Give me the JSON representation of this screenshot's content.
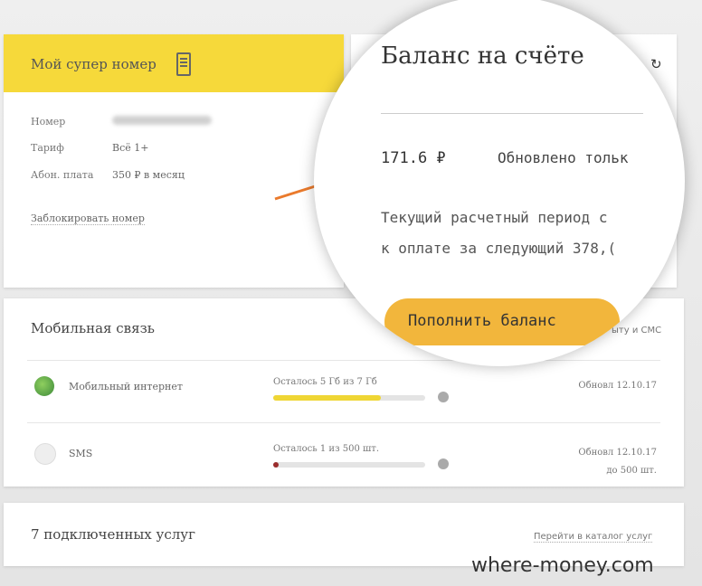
{
  "account": {
    "title": "Мой супер номер",
    "number_label": "Номер",
    "tariff_label": "Тариф",
    "tariff_value": "Всё 1+",
    "fee_label": "Абон. плата",
    "fee_value": "350 ₽ в месяц",
    "block_link": "Заблокировать номер"
  },
  "balance": {
    "title": "Баланс на счёте",
    "amount": "171.6 ₽",
    "updated": "Обновлено тольк",
    "period_line1": "Текущий расчетный период с",
    "period_line2": "к оплате за следующий 378,(",
    "topup_button": "Пополнить баланс"
  },
  "mobile": {
    "title": "Мобильная связь",
    "sms_link": "ыту и СМС",
    "services": [
      {
        "name": "Мобильный интернет",
        "remaining": "Осталось 5 Гб из 7 Гб",
        "progress": 0.71,
        "updated": "Обновл 12.10.17",
        "updated2": ""
      },
      {
        "name": "SMS",
        "remaining": "Осталось 1 из 500 шт.",
        "progress": 0.0,
        "updated": "Обновл 12.10.17",
        "updated2": "до 500 шт."
      }
    ]
  },
  "services_card": {
    "title": "7 подключенных услуг",
    "catalog_link": "Перейти в каталог услуг"
  },
  "watermark": "where-money.com",
  "colors": {
    "brand_yellow": "#f6d93a",
    "topup_orange": "#f2b63c",
    "arrow": "#ea7a2c"
  }
}
